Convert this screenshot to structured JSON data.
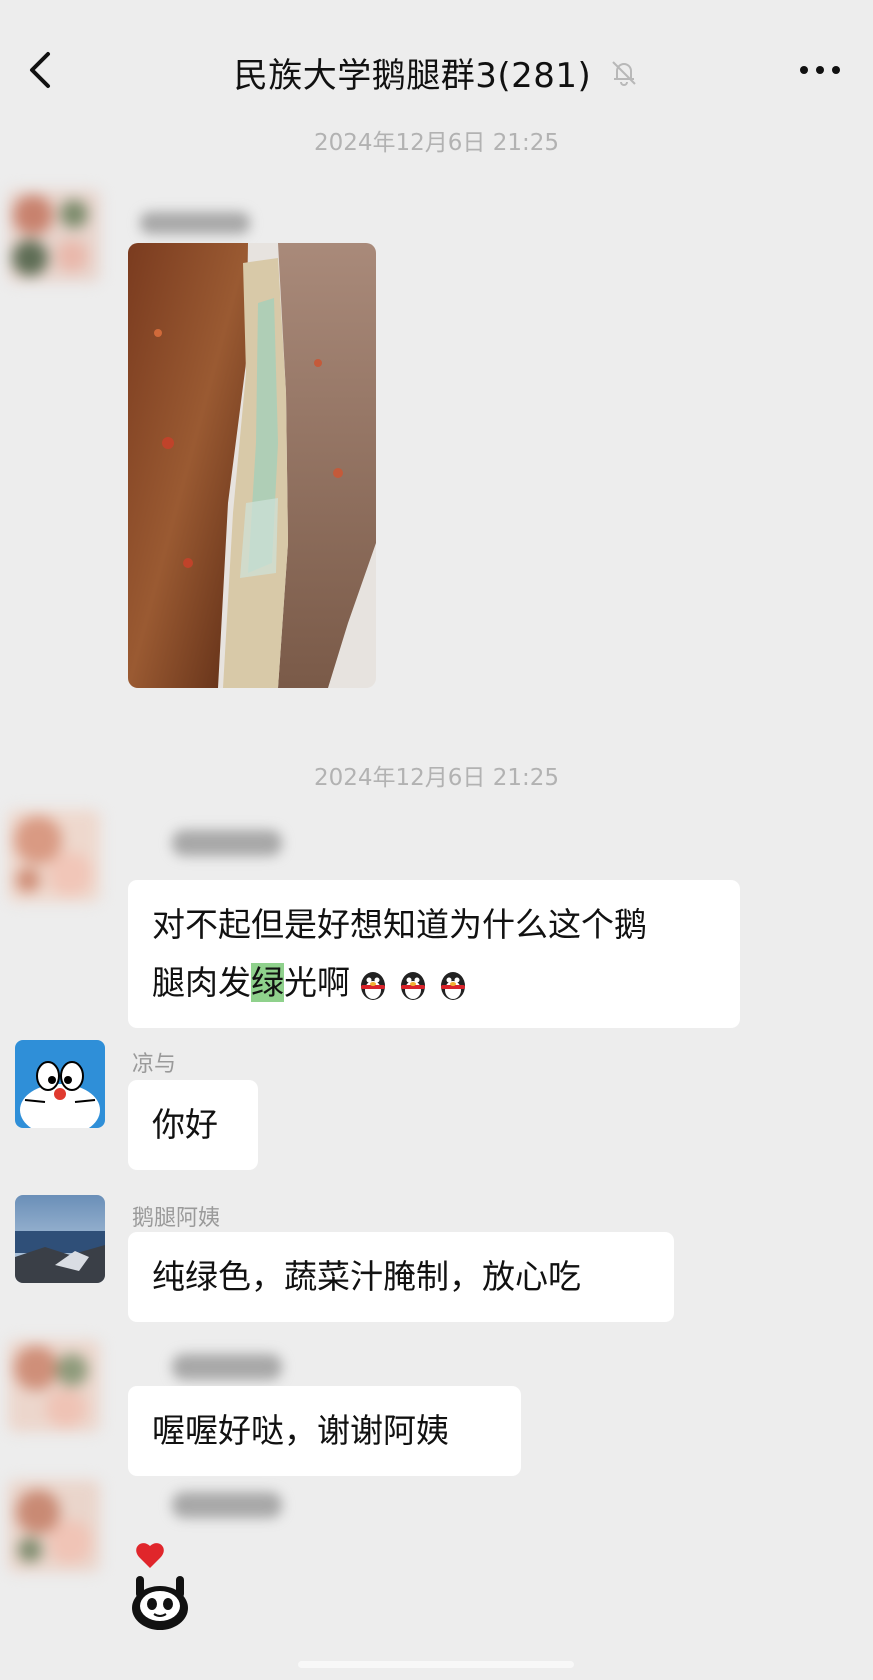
{
  "header": {
    "title": "民族大学鹅腿群3(281)",
    "back_icon": "chevron-left-icon",
    "mute_icon": "bell-off-icon",
    "more_icon": "more-dots-icon"
  },
  "timestamps": [
    "2024年12月6日 21:25",
    "2024年12月6日 21:25"
  ],
  "messages": {
    "m1": {
      "type": "image",
      "description_icon": "goose-leg-photo"
    },
    "m2": {
      "parts": [
        "对不起但是好想知道为什么这个鹅",
        "腿肉发",
        "绿",
        "光啊"
      ],
      "emoji_icon": "qq-penguin-emoji"
    },
    "m3": {
      "sender": "凉与",
      "text": "你好",
      "avatar_icon": "doraemon-avatar"
    },
    "m4": {
      "sender": "鹅腿阿姨",
      "text": "纯绿色，蔬菜汁腌制，放心吃",
      "avatar_icon": "landscape-avatar"
    },
    "m5": {
      "text": "喔喔好哒，谢谢阿姨"
    },
    "m6": {
      "type": "sticker",
      "sticker_icon": "panda-heart-sticker"
    }
  },
  "colors": {
    "background": "#ededed",
    "bubble": "#ffffff",
    "highlight": "#8fd18c",
    "meta_text": "#b2b2b2"
  }
}
